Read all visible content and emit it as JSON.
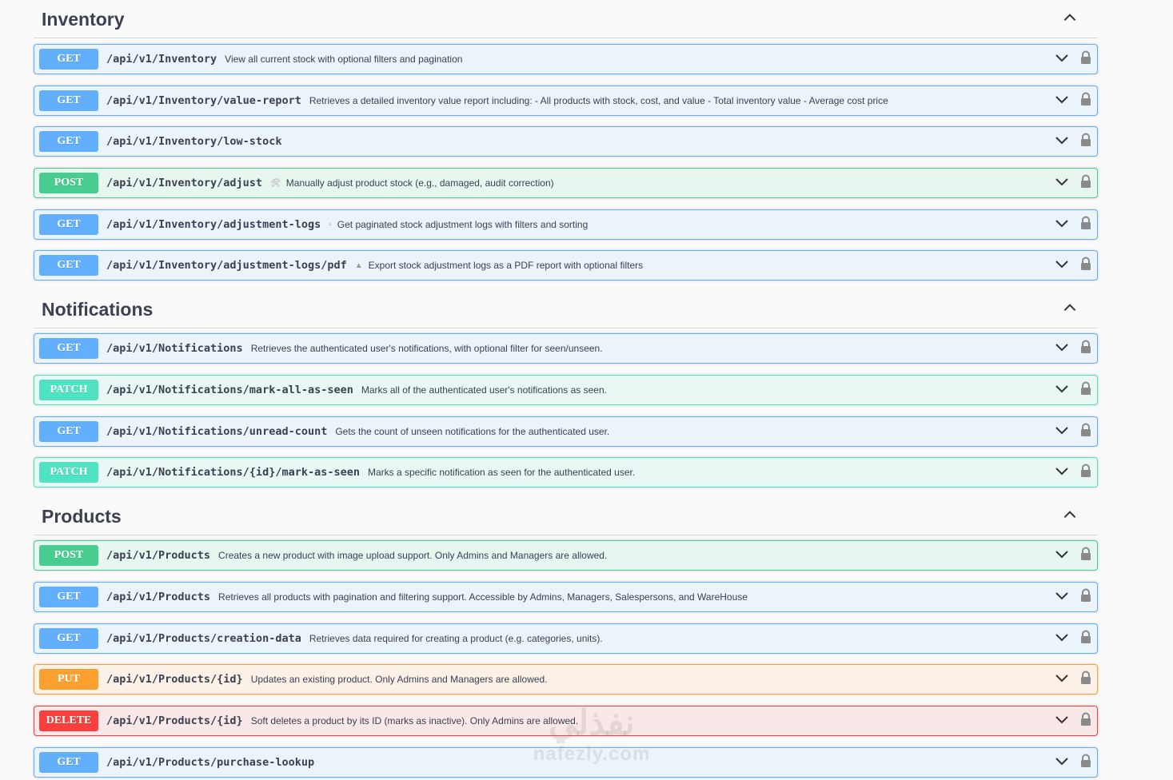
{
  "sections": [
    {
      "title": "Inventory",
      "ops": [
        {
          "method": "GET",
          "path": "/api/v1/Inventory",
          "icon": "",
          "summary": "View all current stock with optional filters and pagination"
        },
        {
          "method": "GET",
          "path": "/api/v1/Inventory/value-report",
          "icon": "",
          "summary": "Retrieves a detailed inventory value report including: - All products with stock, cost, and value - Total inventory value - Average cost price"
        },
        {
          "method": "GET",
          "path": "/api/v1/Inventory/low-stock",
          "icon": "",
          "summary": ""
        },
        {
          "method": "POST",
          "path": "/api/v1/Inventory/adjust",
          "icon": "🛠",
          "summary": "Manually adjust product stock (e.g., damaged, audit correction)"
        },
        {
          "method": "GET",
          "path": "/api/v1/Inventory/adjustment-logs",
          "icon": "▫",
          "summary": "Get paginated stock adjustment logs with filters and sorting"
        },
        {
          "method": "GET",
          "path": "/api/v1/Inventory/adjustment-logs/pdf",
          "icon": "▲",
          "summary": "Export stock adjustment logs as a PDF report with optional filters"
        }
      ]
    },
    {
      "title": "Notifications",
      "ops": [
        {
          "method": "GET",
          "path": "/api/v1/Notifications",
          "icon": "",
          "summary": "Retrieves the authenticated user's notifications, with optional filter for seen/unseen."
        },
        {
          "method": "PATCH",
          "path": "/api/v1/Notifications/mark-all-as-seen",
          "icon": "",
          "summary": "Marks all of the authenticated user's notifications as seen."
        },
        {
          "method": "GET",
          "path": "/api/v1/Notifications/unread-count",
          "icon": "",
          "summary": "Gets the count of unseen notifications for the authenticated user."
        },
        {
          "method": "PATCH",
          "path": "/api/v1/Notifications/{id}/mark-as-seen",
          "icon": "",
          "summary": "Marks a specific notification as seen for the authenticated user."
        }
      ]
    },
    {
      "title": "Products",
      "ops": [
        {
          "method": "POST",
          "path": "/api/v1/Products",
          "icon": "",
          "summary": "Creates a new product with image upload support. Only Admins and Managers are allowed."
        },
        {
          "method": "GET",
          "path": "/api/v1/Products",
          "icon": "",
          "summary": "Retrieves all products with pagination and filtering support. Accessible by Admins, Managers, Salespersons, and WareHouse"
        },
        {
          "method": "GET",
          "path": "/api/v1/Products/creation-data",
          "icon": "",
          "summary": "Retrieves data required for creating a product (e.g. categories, units)."
        },
        {
          "method": "PUT",
          "path": "/api/v1/Products/{id}",
          "icon": "",
          "summary": "Updates an existing product. Only Admins and Managers are allowed."
        },
        {
          "method": "DELETE",
          "path": "/api/v1/Products/{id}",
          "icon": "",
          "summary": "Soft deletes a product by its ID (marks as inactive). Only Admins are allowed."
        },
        {
          "method": "GET",
          "path": "/api/v1/Products/purchase-lookup",
          "icon": "",
          "summary": ""
        }
      ]
    }
  ],
  "watermark": {
    "arabic": "نفذلي",
    "latin": "nafezly.com"
  },
  "colors": {
    "get": "#61affe",
    "post": "#49cc90",
    "patch": "#50e3c2",
    "put": "#fca130",
    "delete": "#f93e3e"
  }
}
